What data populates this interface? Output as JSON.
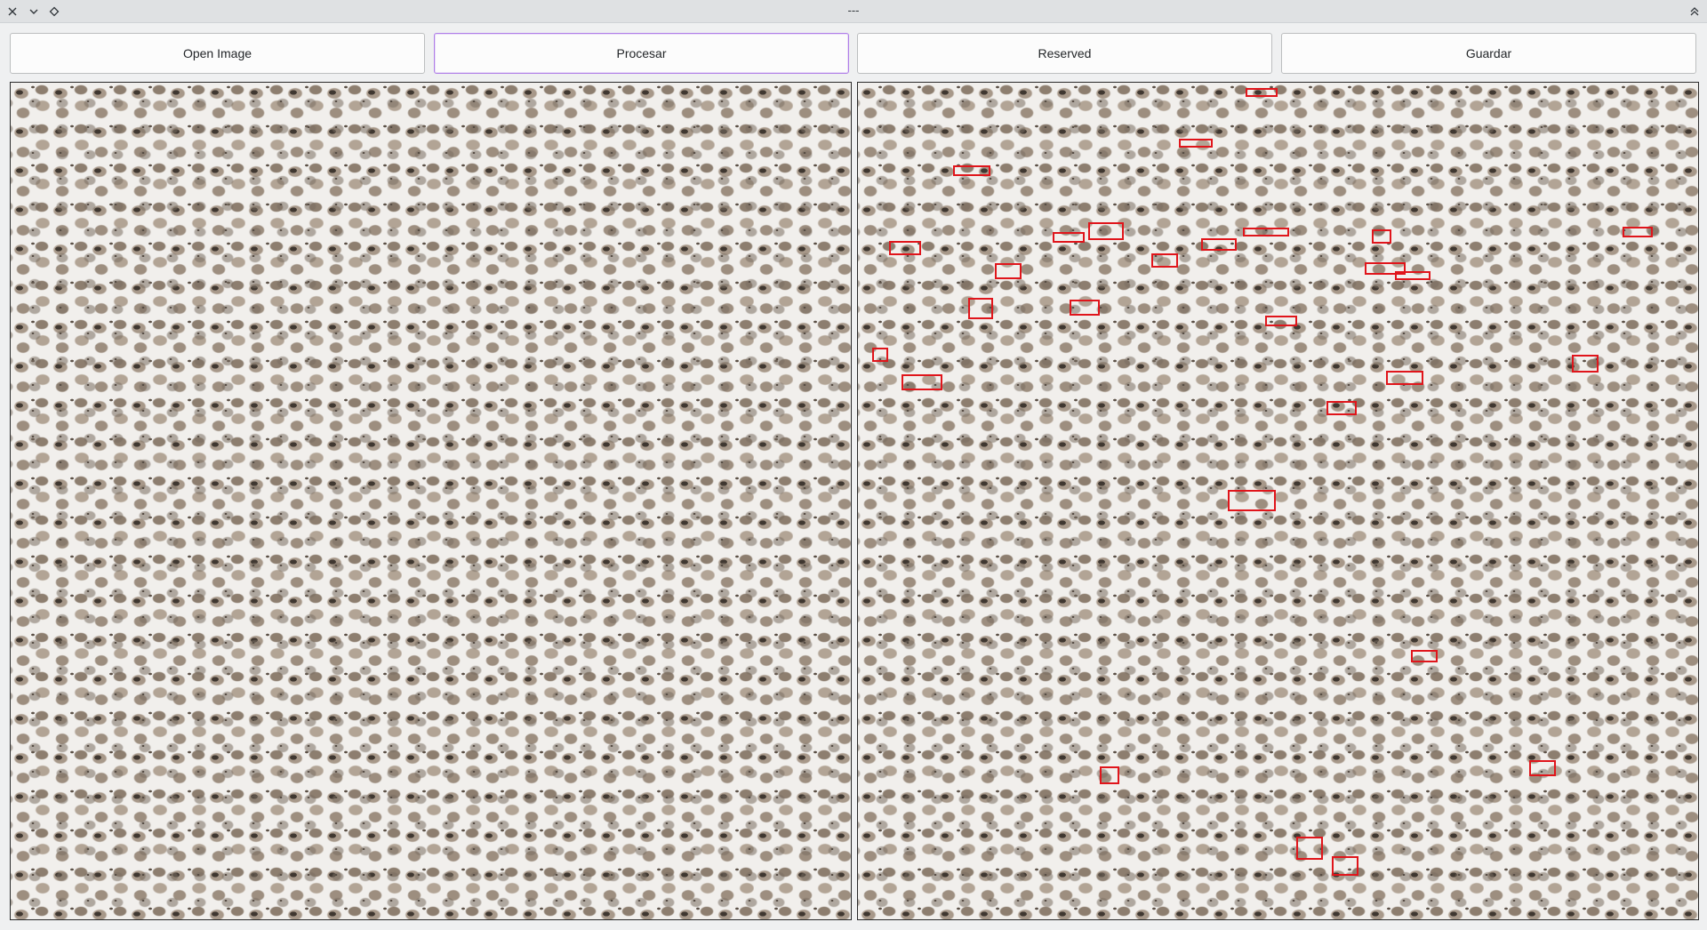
{
  "window": {
    "title": "---",
    "close_icon": "close-icon",
    "minimize_icon": "chevron-down-icon",
    "keep_above_icon": "diamond-icon",
    "maximize_icon": "double-chevron-up-icon"
  },
  "toolbar": {
    "open_label": "Open Image",
    "process_label": "Procesar",
    "reserved_label": "Reserved",
    "save_label": "Guardar"
  },
  "panels": {
    "original": "original-image",
    "processed": "processed-image",
    "detection_color": "#e0151b"
  }
}
